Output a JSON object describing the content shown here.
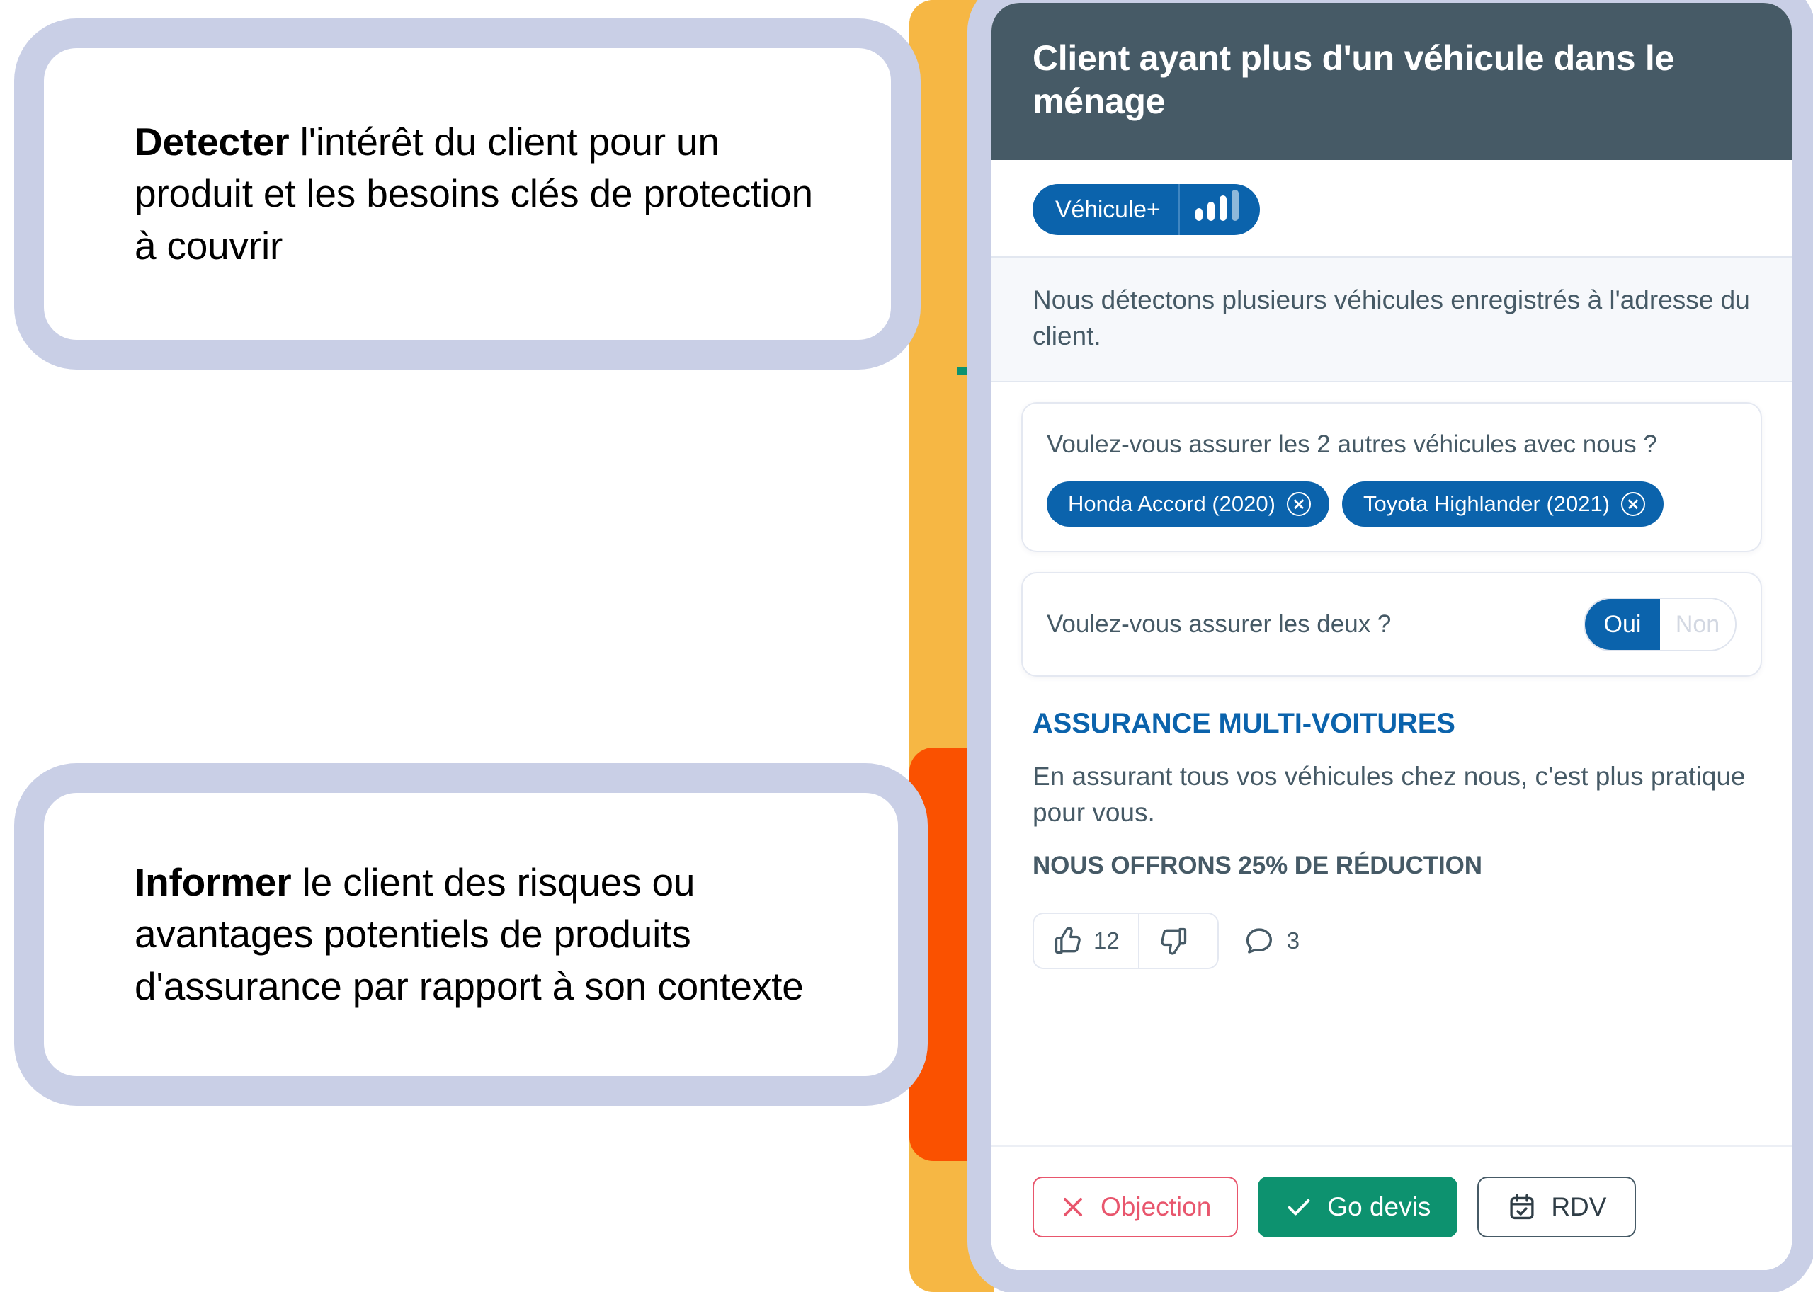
{
  "left_cards": [
    {
      "id": "detecter",
      "bold_lead": "Detecter",
      "rest": " l'intérêt du client pour un produit et les besoins clés de protection à couvrir",
      "accent_color": "#F6B744"
    },
    {
      "id": "informer",
      "bold_lead": "Informer",
      "rest": " le client des risques ou avantages potentiels de produits d'assurance par rapport à son contexte",
      "accent_color": "#FA5100"
    }
  ],
  "panel": {
    "header": {
      "title": "Client ayant plus d'un véhicule dans le ménage",
      "background": "#465A66"
    },
    "badge": {
      "label": "Véhicule+",
      "icon": "signal-bars-icon",
      "bars_total": 4,
      "bars_filled": 3,
      "background": "#0B63AC"
    },
    "detection": {
      "text": "Nous détectons plusieurs véhicules enregistrés à l'adresse du client."
    },
    "vehicles_card": {
      "question": "Voulez-vous assurer les 2 autres véhicules avec nous ?",
      "chips": [
        {
          "label": "Honda Accord (2020)",
          "remove_icon": "circle-x-icon"
        },
        {
          "label": "Toyota Highlander (2021)",
          "remove_icon": "circle-x-icon"
        }
      ]
    },
    "toggle_card": {
      "question": "Voulez-vous assurer les deux ?",
      "options": [
        {
          "label": "Oui",
          "selected": true
        },
        {
          "label": "Non",
          "selected": false
        }
      ]
    },
    "promo": {
      "title": "ASSURANCE MULTI-VOITURES",
      "body": "En assurant tous vos véhicules chez nous, c'est plus pratique pour vous.",
      "offer": "NOUS OFFRONS 25% DE RÉDUCTION",
      "title_color": "#0B63AC"
    },
    "reactions": {
      "like": {
        "icon": "thumbs-up-icon",
        "count": "12"
      },
      "dislike": {
        "icon": "thumbs-down-icon",
        "count": ""
      },
      "comment": {
        "icon": "comment-bubble-icon",
        "count": "3"
      }
    },
    "actions": [
      {
        "id": "objection",
        "label": "Objection",
        "icon": "close-x-icon",
        "color": "#E8566D",
        "style": "outline"
      },
      {
        "id": "go-devis",
        "label": "Go devis",
        "icon": "check-icon",
        "color": "#0D926F",
        "style": "solid"
      },
      {
        "id": "rdv",
        "label": "RDV",
        "icon": "calendar-check-icon",
        "color": "#465A66",
        "style": "outline"
      }
    ]
  }
}
